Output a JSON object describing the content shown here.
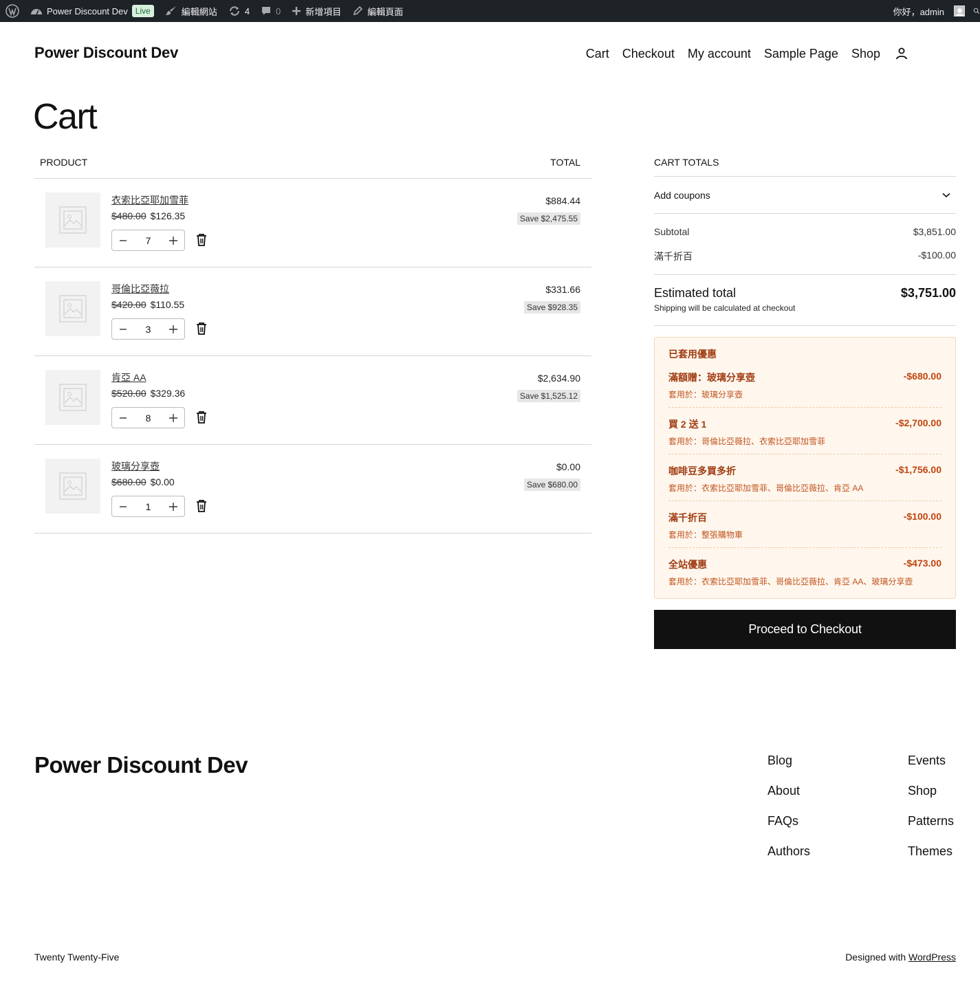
{
  "admin_bar": {
    "site_name": "Power Discount Dev",
    "live_badge": "Live",
    "edit_site": "編輯網站",
    "updates_count": "4",
    "comments_count": "0",
    "new_item": "新增項目",
    "edit_page": "編輯頁面",
    "greeting": "你好，admin"
  },
  "header": {
    "site_title": "Power Discount Dev",
    "nav": [
      "Cart",
      "Checkout",
      "My account",
      "Sample Page",
      "Shop"
    ]
  },
  "page": {
    "title": "Cart"
  },
  "cart": {
    "col_product": "PRODUCT",
    "col_total": "TOTAL",
    "items": [
      {
        "name": "衣索比亞耶加雪菲",
        "old_price": "$480.00",
        "price": "$126.35",
        "qty": "7",
        "total": "$884.44",
        "save": "Save $2,475.55"
      },
      {
        "name": "哥倫比亞薇拉",
        "old_price": "$420.00",
        "price": "$110.55",
        "qty": "3",
        "total": "$331.66",
        "save": "Save $928.35"
      },
      {
        "name": "肯亞 AA",
        "old_price": "$520.00",
        "price": "$329.36",
        "qty": "8",
        "total": "$2,634.90",
        "save": "Save $1,525.12"
      },
      {
        "name": "玻璃分享壺",
        "old_price": "$680.00",
        "price": "$0.00",
        "qty": "1",
        "total": "$0.00",
        "save": "Save $680.00"
      }
    ]
  },
  "totals": {
    "heading": "CART TOTALS",
    "add_coupons": "Add coupons",
    "subtotal_label": "Subtotal",
    "subtotal_value": "$3,851.00",
    "discount_label": "滿千折百",
    "discount_value": "-$100.00",
    "estimated_label": "Estimated total",
    "estimated_value": "$3,751.00",
    "shipping_note": "Shipping will be calculated at checkout",
    "applied_title": "已套用優惠",
    "applied": [
      {
        "name": "滿額贈：玻璃分享壺",
        "amount": "-$680.00",
        "applies": "套用於：玻璃分享壺"
      },
      {
        "name": "買 2 送 1",
        "amount": "-$2,700.00",
        "applies": "套用於：哥倫比亞薇拉、衣索比亞耶加雪菲"
      },
      {
        "name": "咖啡豆多買多折",
        "amount": "-$1,756.00",
        "applies": "套用於：衣索比亞耶加雪菲、哥倫比亞薇拉、肯亞 AA"
      },
      {
        "name": "滿千折百",
        "amount": "-$100.00",
        "applies": "套用於：整張購物車"
      },
      {
        "name": "全站優惠",
        "amount": "-$473.00",
        "applies": "套用於：衣索比亞耶加雪菲、哥倫比亞薇拉、肯亞 AA、玻璃分享壺"
      }
    ],
    "checkout_button": "Proceed to Checkout"
  },
  "footer": {
    "title": "Power Discount Dev",
    "col1": [
      "Blog",
      "About",
      "FAQs",
      "Authors"
    ],
    "col2": [
      "Events",
      "Shop",
      "Patterns",
      "Themes"
    ],
    "theme": "Twenty Twenty-Five",
    "credit_prefix": "Designed with ",
    "credit_link": "WordPress"
  }
}
